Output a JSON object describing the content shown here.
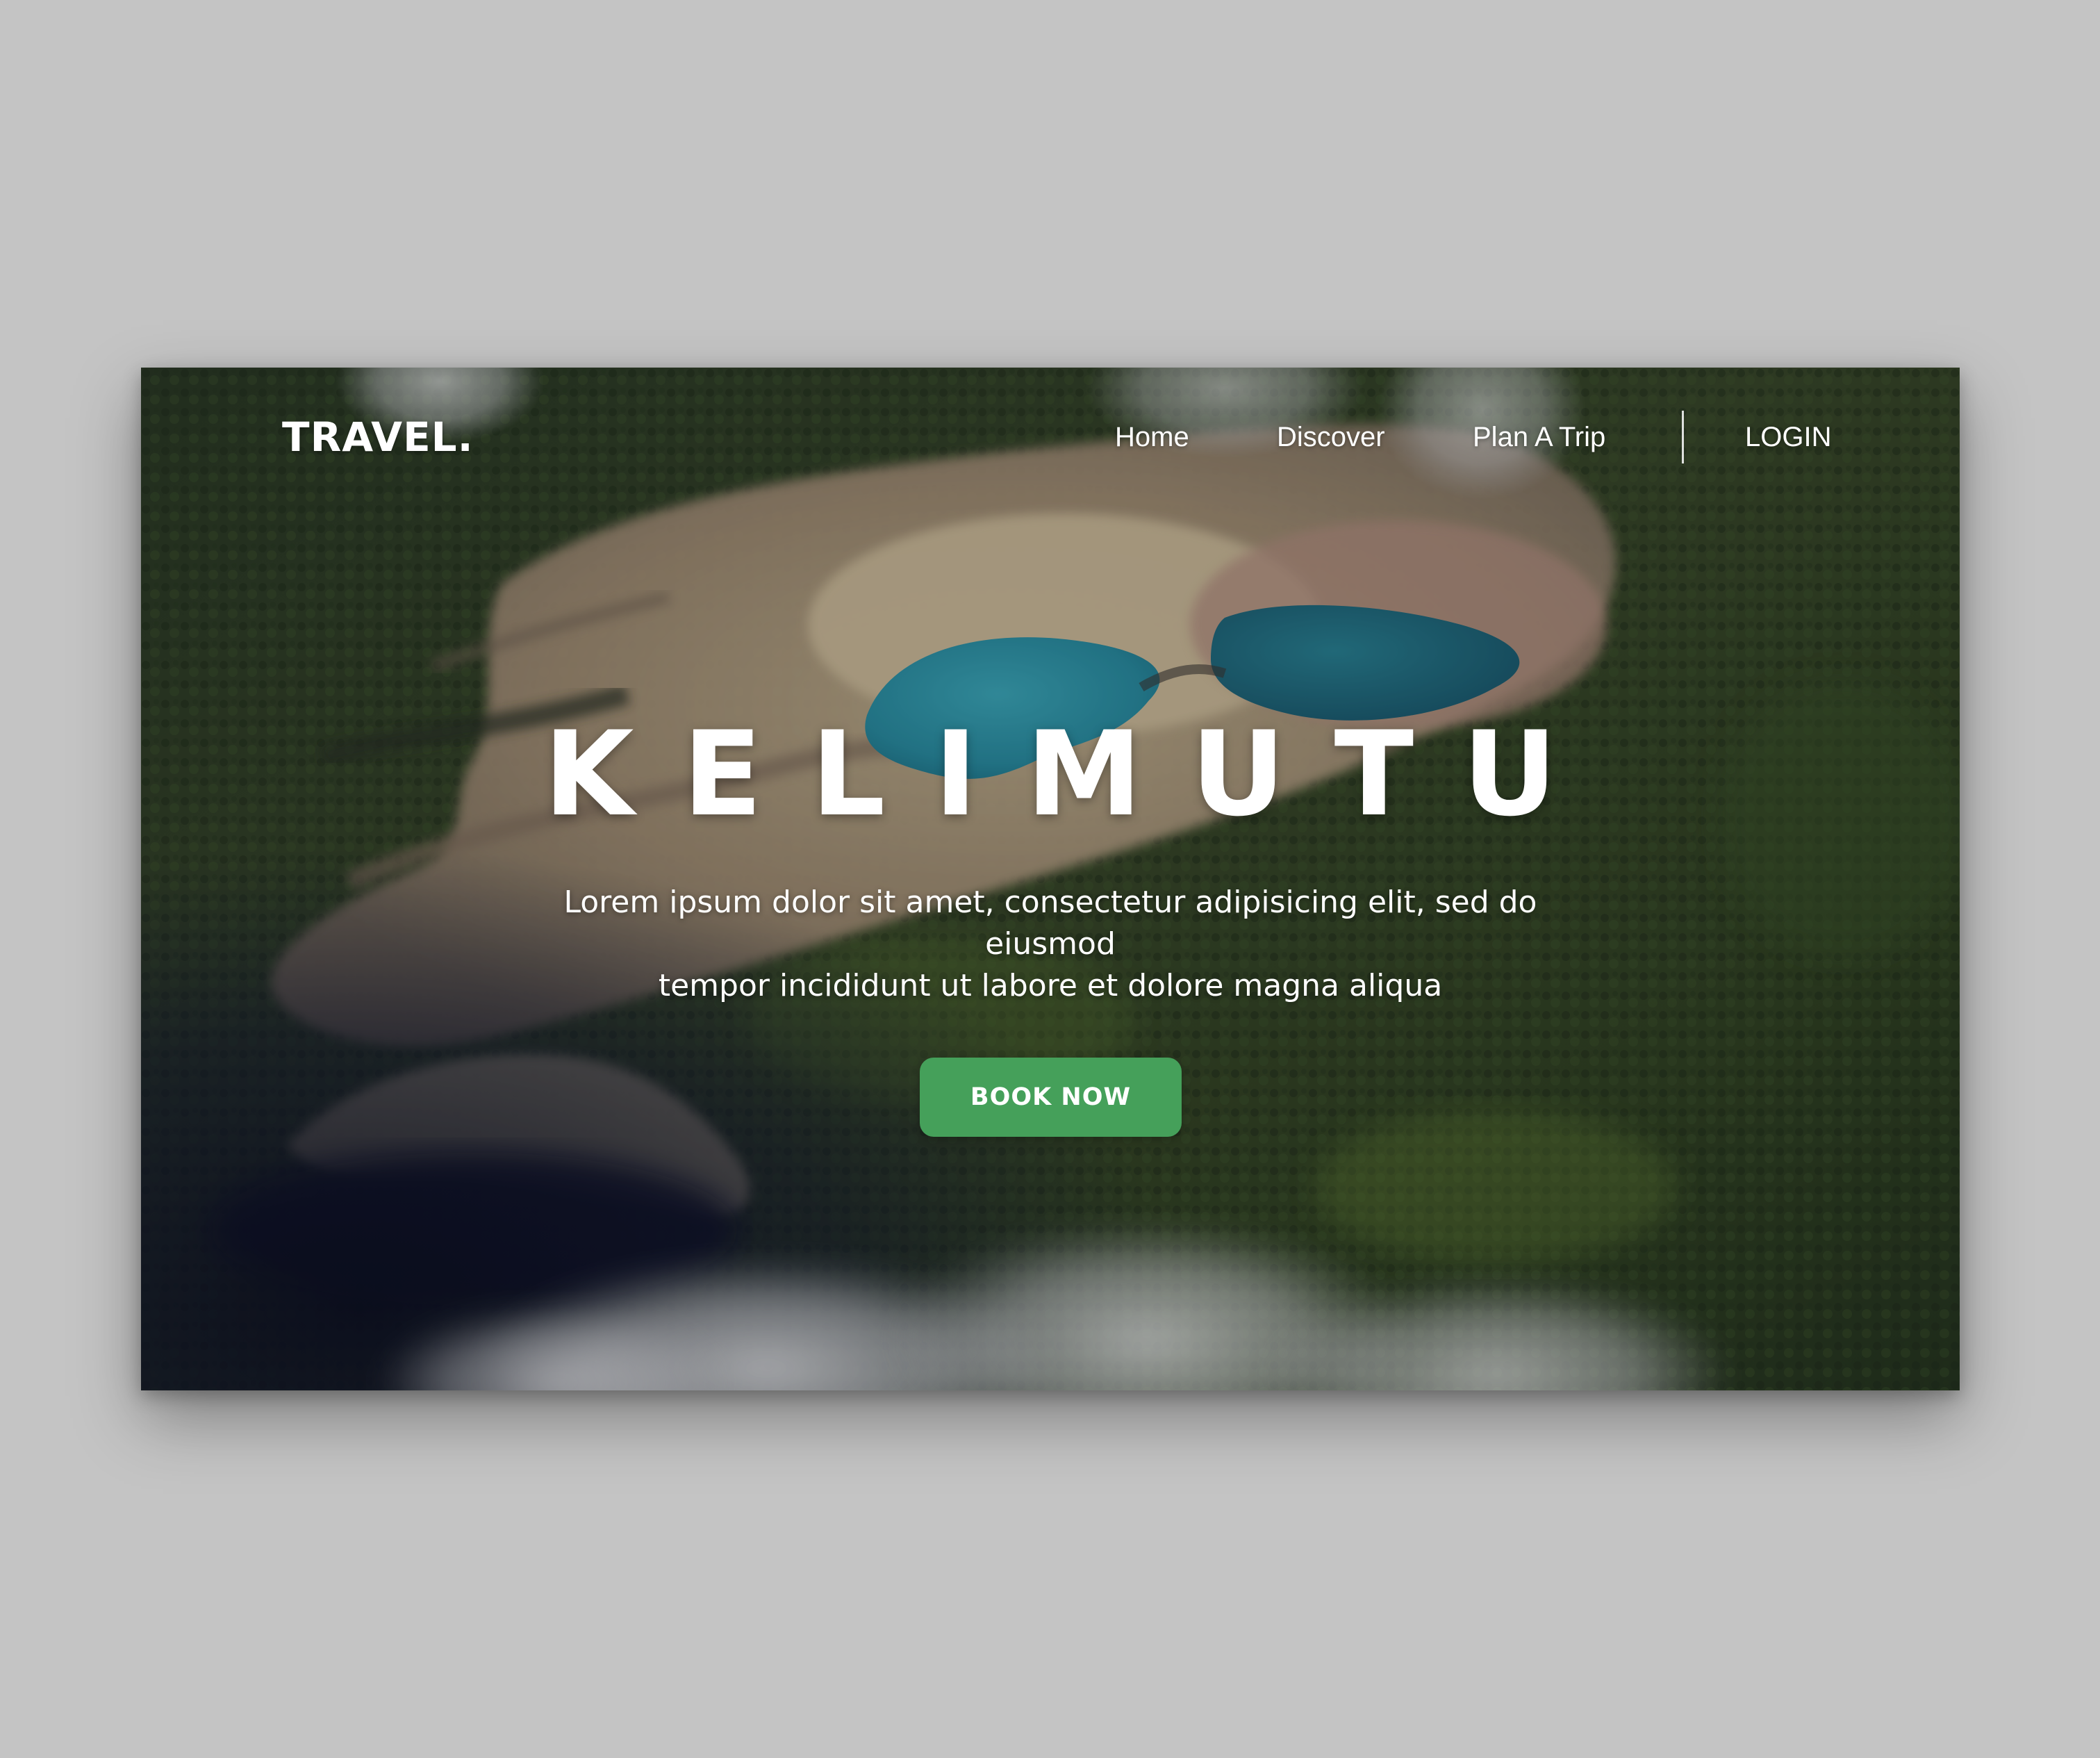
{
  "site": {
    "logo": "TRAVEL."
  },
  "nav": {
    "items": [
      {
        "label": "Home"
      },
      {
        "label": "Discover"
      },
      {
        "label": "Plan A Trip"
      }
    ],
    "login_label": "LOGIN"
  },
  "hero": {
    "title": "KELIMUTU",
    "subtitle_line1": "Lorem ipsum dolor sit amet, consectetur adipisicing elit, sed do eiusmod",
    "subtitle_line2": "tempor incididunt ut labore et dolore magna aliqua",
    "cta_label": "BOOK NOW",
    "background": "aerial-crater-lakes-photo"
  },
  "colors": {
    "page_background": "#c4c4c4",
    "cta": "#45a05a",
    "text": "#ffffff",
    "lake_turquoise": "#2fa3b4",
    "lake_teal": "#1f6f83",
    "forest": "#2f4220"
  }
}
